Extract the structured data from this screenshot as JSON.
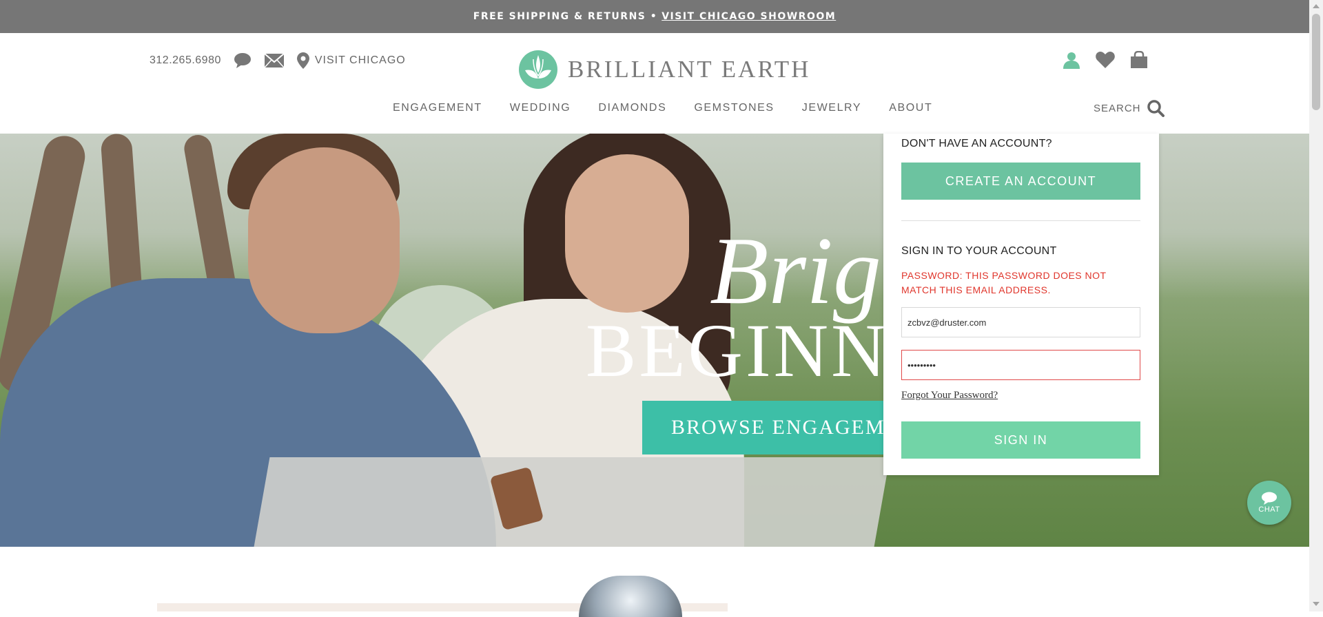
{
  "promo": {
    "text": "FREE SHIPPING & RETURNS •",
    "link": "VISIT CHICAGO SHOWROOM"
  },
  "header": {
    "phone": "312.265.6980",
    "visit": "VISIT CHICAGO",
    "brand": "BRILLIANT EARTH",
    "search_label": "SEARCH"
  },
  "nav": [
    "ENGAGEMENT",
    "WEDDING",
    "DIAMONDS",
    "GEMSTONES",
    "JEWELRY",
    "ABOUT"
  ],
  "hero": {
    "title_script": "Brig",
    "title_caps": "BEGINN",
    "cta": "BROWSE ENGAGEMENT"
  },
  "account_dropdown": {
    "no_account": "DON'T HAVE AN ACCOUNT?",
    "create_button": "CREATE AN ACCOUNT",
    "sign_in_heading": "SIGN IN TO YOUR ACCOUNT",
    "error": "PASSWORD: THIS PASSWORD DOES NOT MATCH THIS EMAIL ADDRESS.",
    "email_value": "zcbvz@druster.com",
    "password_value": "•••••••••",
    "forgot_link": "Forgot Your Password?",
    "sign_in_button": "SIGN IN"
  },
  "chat": {
    "label": "CHAT"
  },
  "colors": {
    "accent": "#6cc3a0",
    "cta_teal": "#3dbfa7",
    "error": "#e0362c",
    "promo_bg": "#767676"
  }
}
